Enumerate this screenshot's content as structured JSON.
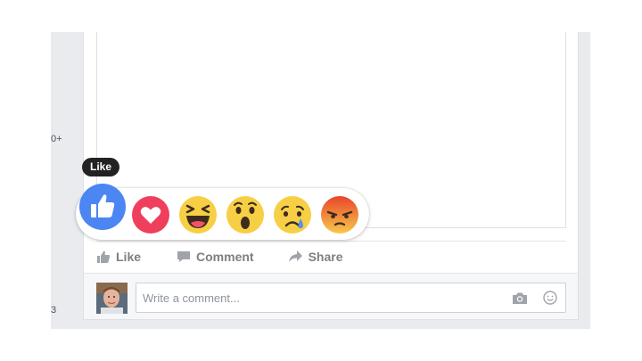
{
  "side": {
    "top_text": "0+",
    "bottom_text": "3"
  },
  "tooltip": {
    "label": "Like"
  },
  "reactions": [
    {
      "name": "like",
      "color": "#4b86f2"
    },
    {
      "name": "love",
      "color": "#ef3f5c"
    },
    {
      "name": "haha",
      "color": "#f7cf45"
    },
    {
      "name": "wow",
      "color": "#f7cf45"
    },
    {
      "name": "sad",
      "color": "#f7cf45"
    },
    {
      "name": "angry",
      "color": "#f06b3a"
    }
  ],
  "actions": {
    "like_label": "Like",
    "comment_label": "Comment",
    "share_label": "Share"
  },
  "comment": {
    "placeholder": "Write a comment..."
  },
  "colors": {
    "feed_background": "#e9ebee",
    "action_text": "#7f7f7f",
    "tooltip_background": "#222222"
  }
}
